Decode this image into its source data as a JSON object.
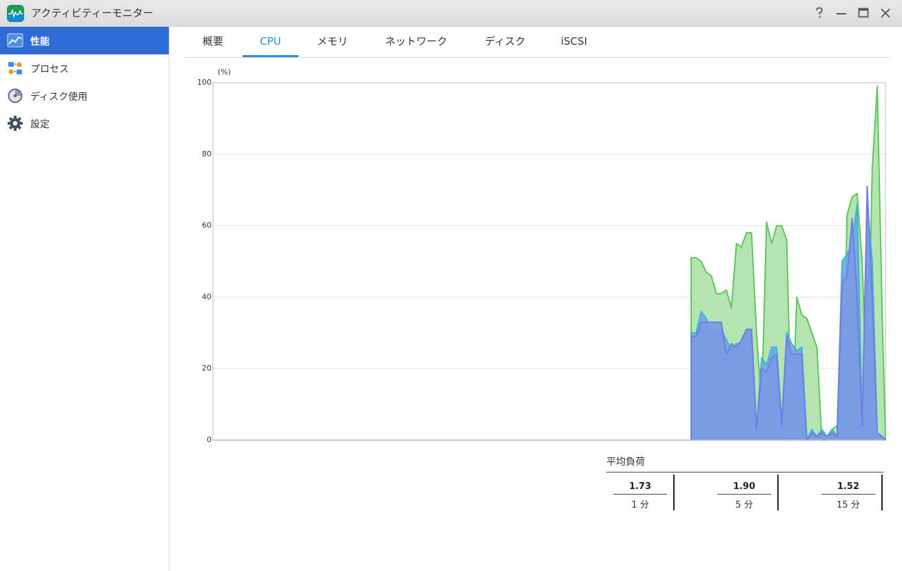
{
  "window": {
    "title": "アクティビティーモニター",
    "controls": [
      "help-icon",
      "minimize-icon",
      "maximize-icon",
      "close-icon"
    ]
  },
  "sidebar": {
    "items": [
      {
        "label": "性能",
        "icon": "performance-chart-icon",
        "active": true
      },
      {
        "label": "プロセス",
        "icon": "process-icon",
        "active": false
      },
      {
        "label": "ディスク使用",
        "icon": "disk-usage-icon",
        "active": false
      },
      {
        "label": "設定",
        "icon": "gear-icon",
        "active": false
      }
    ]
  },
  "tabs": [
    {
      "label": "概要",
      "active": false
    },
    {
      "label": "CPU",
      "active": true
    },
    {
      "label": "メモリ",
      "active": false
    },
    {
      "label": "ネットワーク",
      "active": false
    },
    {
      "label": "ディスク",
      "active": false
    },
    {
      "label": "iSCSI",
      "active": false
    }
  ],
  "chart_data": {
    "type": "area",
    "unit_label": "(%)",
    "ylim": [
      0,
      100
    ],
    "yticks": [
      0,
      20,
      40,
      60,
      80,
      100
    ],
    "grid": true,
    "total_points": 143,
    "series": [
      {
        "color": "#5cc760",
        "fill": "#b6e4b0",
        "values": [
          51,
          51,
          50,
          47,
          46,
          41,
          41,
          42,
          37,
          55,
          54,
          58,
          58,
          30,
          10,
          61,
          55,
          60,
          60,
          56,
          0,
          40,
          35,
          34,
          30,
          26,
          0,
          0,
          3,
          4,
          1,
          63,
          68,
          69,
          50,
          8,
          76,
          99,
          34,
          1,
          3,
          2,
          0,
          0,
          0,
          0,
          0,
          0,
          0,
          0,
          0,
          0,
          0,
          0,
          0,
          0,
          0,
          0,
          0,
          0,
          0,
          0,
          0,
          0,
          0,
          0,
          0,
          0,
          0,
          0,
          0,
          0,
          0,
          0,
          0,
          0,
          0,
          0,
          0,
          0,
          0,
          0,
          0,
          0,
          0,
          0,
          0,
          0,
          0,
          0,
          0,
          0,
          0,
          0,
          0,
          0,
          0,
          0,
          0,
          0,
          0,
          0,
          0,
          0,
          0,
          0,
          0,
          0,
          0,
          0,
          0,
          0,
          0,
          0,
          0,
          0,
          0,
          0,
          0,
          0,
          0,
          0,
          0,
          0,
          0,
          0,
          0,
          0,
          0,
          0,
          0,
          0,
          0,
          0,
          0,
          0,
          0,
          0,
          0,
          0,
          0,
          0,
          0
        ]
      },
      {
        "color": "#3fb2d6",
        "fill": "#6fa8e6",
        "values": [
          30,
          30,
          36,
          34,
          31,
          30,
          31,
          28,
          25,
          27,
          27,
          31,
          31,
          3,
          23,
          21,
          26,
          26,
          5,
          30,
          27,
          25,
          26,
          0,
          3,
          1,
          3,
          1,
          3,
          1,
          50,
          52,
          55,
          66,
          5,
          66,
          50,
          2,
          1,
          2,
          2,
          0,
          0,
          0,
          0,
          0,
          0,
          0,
          0,
          0,
          0,
          0,
          0,
          0,
          0,
          0,
          0,
          0,
          0,
          0,
          0,
          0,
          0,
          0,
          0,
          0,
          0,
          0,
          0,
          0,
          0,
          0,
          0,
          0,
          0,
          0,
          0,
          0,
          0,
          0,
          0,
          0,
          0,
          0,
          0,
          0,
          0,
          0,
          0,
          0,
          0,
          0,
          0,
          0,
          0,
          0,
          0,
          0,
          0,
          0,
          0,
          0,
          0,
          0,
          0,
          0,
          0,
          0,
          0,
          0,
          0,
          0,
          0,
          0,
          0,
          0,
          0,
          0,
          0,
          0,
          0,
          0,
          0,
          0,
          0,
          0,
          0,
          0,
          0,
          0,
          0,
          0,
          0,
          0,
          0,
          0,
          0,
          0,
          0,
          0,
          0,
          0,
          0
        ]
      },
      {
        "color": "#6f7de6",
        "fill": "#7b9ae3",
        "values": [
          29,
          29,
          33,
          33,
          33,
          33,
          33,
          24,
          27,
          26,
          28,
          31,
          31,
          3,
          20,
          19,
          23,
          24,
          4,
          29,
          24,
          24,
          24,
          0,
          2,
          1,
          2,
          1,
          2,
          1,
          44,
          46,
          62,
          40,
          4,
          71,
          40,
          2,
          1,
          1,
          1,
          0,
          0,
          0,
          0,
          0,
          0,
          0,
          0,
          0,
          0,
          0,
          0,
          0,
          0,
          0,
          0,
          0,
          0,
          0,
          0,
          0,
          0,
          0,
          0,
          0,
          0,
          0,
          0,
          0,
          0,
          0,
          0,
          0,
          0,
          0,
          0,
          0,
          0,
          0,
          0,
          0,
          0,
          0,
          0,
          0,
          0,
          0,
          0,
          0,
          0,
          0,
          0,
          0,
          0,
          0,
          0,
          0,
          0,
          0,
          0,
          0,
          0,
          0,
          0,
          0,
          0,
          0,
          0,
          0,
          0,
          0,
          0,
          0,
          0,
          0,
          0,
          0,
          0,
          0,
          0,
          0,
          0,
          0,
          0,
          0,
          0,
          0,
          0,
          0,
          0,
          0,
          0,
          0,
          0,
          0,
          0,
          0,
          0,
          0,
          0,
          0,
          0
        ]
      }
    ]
  },
  "load_average": {
    "title": "平均負荷",
    "items": [
      {
        "value": "1.73",
        "label": "1 分"
      },
      {
        "value": "1.90",
        "label": "5 分"
      },
      {
        "value": "1.52",
        "label": "15 分"
      }
    ]
  }
}
